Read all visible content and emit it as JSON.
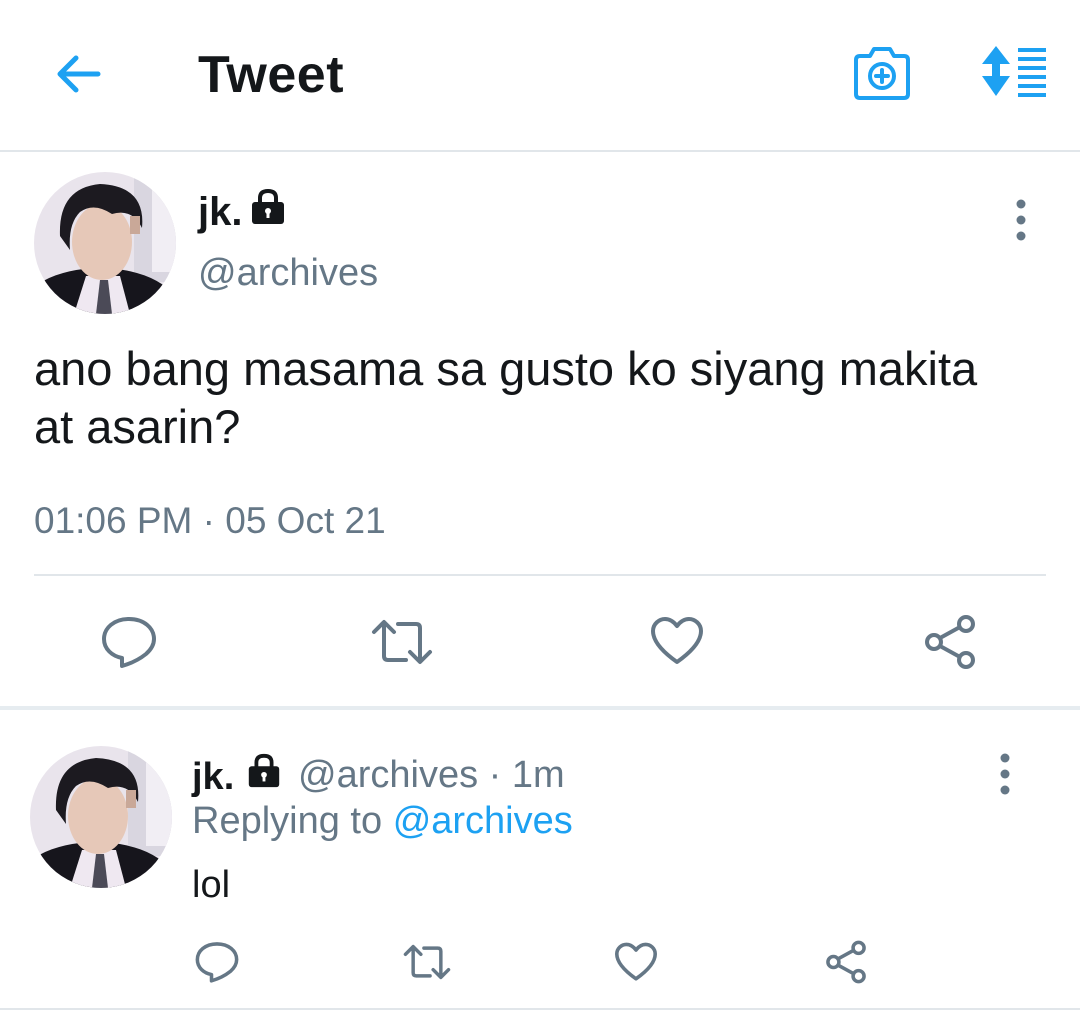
{
  "header": {
    "title": "Tweet",
    "icons": [
      "back-arrow-icon",
      "add-photo-camera-icon",
      "sort-icon"
    ],
    "accent": "#1da1f2"
  },
  "tweet": {
    "name": "jk.",
    "handle": "@archives",
    "text": "ano bang masama sa gusto ko siyang makita at asarin?",
    "timestamp": "01:06 PM · 05 Oct 21",
    "icons": [
      "lock-icon",
      "more-vertical-icon",
      "reply-icon",
      "retweet-icon",
      "like-icon",
      "share-icon"
    ]
  },
  "reply": {
    "name": "jk.",
    "meta": "@archives · 1m",
    "replying_prefix": "Replying to",
    "replying_handle": "@archives",
    "text": "lol"
  },
  "colors": {
    "text_primary": "#14171a",
    "text_secondary": "#657786",
    "link": "#1da1f2",
    "divider": "#e1e6ea"
  }
}
